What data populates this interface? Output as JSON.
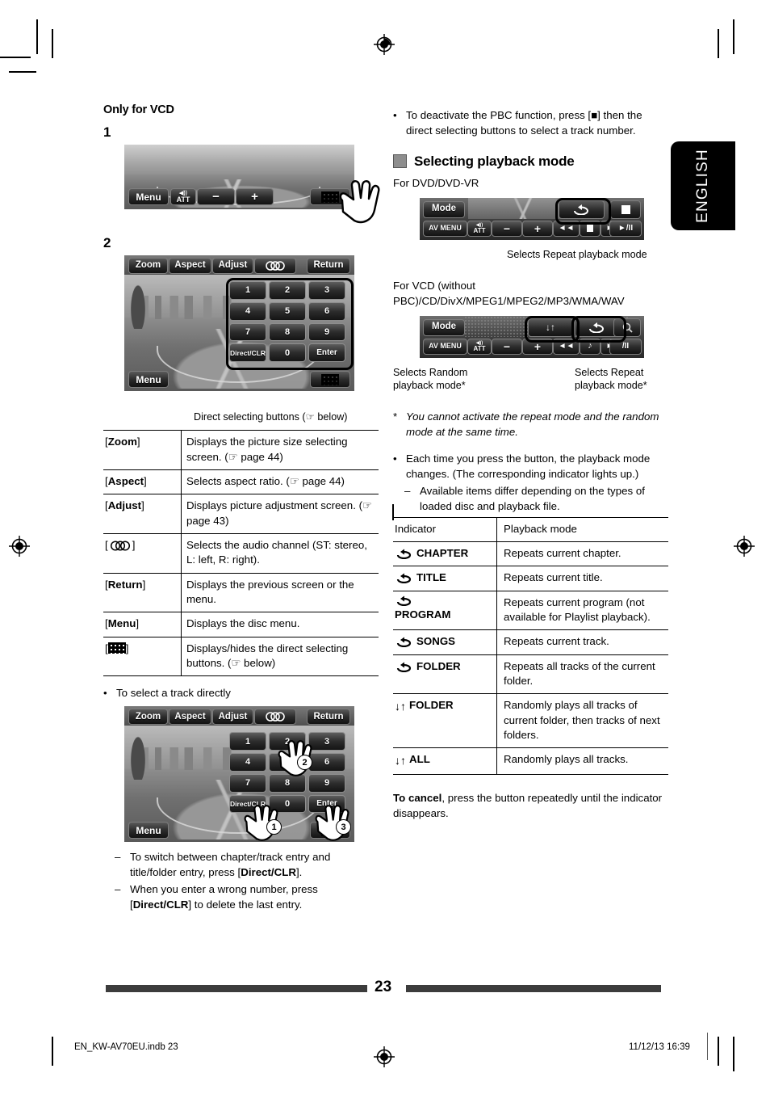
{
  "page": {
    "number": "23",
    "language_tab": "ENGLISH",
    "footer_file": "EN_KW-AV70EU.indb   23",
    "footer_datetime": "11/12/13   16:39"
  },
  "left_column": {
    "heading": "Only for VCD",
    "step1_number": "1",
    "step2_number": "2",
    "screen_toolbar": {
      "zoom": "Zoom",
      "aspect": "Aspect",
      "adjust": "Adjust",
      "audio_icon": "audio-channel-icon",
      "return": "Return",
      "menu": "Menu",
      "att": "ATT",
      "minus": "−",
      "plus": "+",
      "keypad_icon": "keypad-icon"
    },
    "keypad": {
      "keys": [
        "1",
        "2",
        "3",
        "4",
        "5",
        "6",
        "7",
        "8",
        "9",
        "Direct/CLR",
        "0",
        "Enter"
      ]
    },
    "keypad_caption": "Direct selecting buttons (☞ below)",
    "button_table": {
      "rows": [
        {
          "key": "[Zoom]",
          "key_bold": "Zoom",
          "desc": "Displays the picture size selecting screen. (☞ page 44)"
        },
        {
          "key": "[Aspect]",
          "key_bold": "Aspect",
          "desc": "Selects aspect ratio. (☞ page 44)"
        },
        {
          "key": "[Adjust]",
          "key_bold": "Adjust",
          "desc": "Displays picture adjustment screen. (☞ page 43)"
        },
        {
          "key": "[audio-icon]",
          "key_bold": "",
          "desc": "Selects the audio channel (ST: stereo, L: left, R: right)."
        },
        {
          "key": "[Return]",
          "key_bold": "Return",
          "desc": "Displays the previous screen or the menu."
        },
        {
          "key": "[Menu]",
          "key_bold": "Menu",
          "desc": "Displays the disc menu."
        },
        {
          "key": "[keypad-icon]",
          "key_bold": "",
          "desc": "Displays/hides the direct selecting buttons. (☞ below)"
        }
      ]
    },
    "track_bullet": "To select a track directly",
    "callout_numbers": [
      "1",
      "2",
      "3"
    ],
    "notes": [
      {
        "lead": "To switch between chapter/track entry and title/folder entry, press [",
        "bold": "Direct/CLR",
        "tail": "]."
      },
      {
        "lead": "When you enter a wrong number, press [",
        "bold": "Direct/CLR",
        "tail": "] to delete the last entry."
      }
    ]
  },
  "right_column": {
    "pbc_bullet": "To deactivate the PBC function, press [■] then the direct selecting buttons to select a track number.",
    "section_title": "Selecting playback mode",
    "dvd_label": "For DVD/DVD-VR",
    "dvd_bar": {
      "mode": "Mode",
      "av_menu": "AV MENU",
      "att": "ATT",
      "minus": "−",
      "plus": "+",
      "prev": "◄◄",
      "stop_small": "stop-icon",
      "next": "►►",
      "play_pause": "►/II",
      "repeat_icon": "repeat-icon",
      "stop_icon": "stop-icon"
    },
    "dvd_caption": "Selects Repeat playback mode",
    "vcd_label": "For VCD (without PBC)/CD/DivX/MPEG1/MPEG2/MP3/WMA/WAV",
    "vcd_bar": {
      "mode": "Mode",
      "av_menu": "AV MENU",
      "att": "ATT",
      "minus": "−",
      "plus": "+",
      "prev": "◄◄",
      "note_icon": "music-note-icon",
      "next": "►►",
      "play_pause": "/II",
      "random_icon": "random-icon",
      "repeat_icon": "repeat-icon"
    },
    "vcd_caption_left": "Selects Random playback mode*",
    "vcd_caption_right": "Selects Repeat playback mode*",
    "footnote": "You cannot activate the repeat mode and the random mode at the same time.",
    "footnote_mark": "*",
    "bullet_each": "Each time you press the button, the playback mode changes. (The corresponding indicator lights up.)",
    "dash_available": "Available items differ depending on the types of loaded disc and playback file.",
    "indicator_table": {
      "header": {
        "indicator": "Indicator",
        "mode": "Playback mode"
      },
      "rows": [
        {
          "icon": "repeat-icon",
          "label": "CHAPTER",
          "desc": "Repeats current chapter."
        },
        {
          "icon": "repeat-icon",
          "label": "TITLE",
          "desc": "Repeats current title."
        },
        {
          "icon": "repeat-icon",
          "label": "PROGRAM",
          "desc": "Repeats current program (not available for Playlist playback).",
          "wrap": true
        },
        {
          "icon": "repeat-icon",
          "label": "SONGS",
          "desc": "Repeats current track."
        },
        {
          "icon": "repeat-icon",
          "label": "FOLDER",
          "desc": "Repeats all tracks of the current folder."
        },
        {
          "icon": "random-icon",
          "label": "FOLDER",
          "desc": "Randomly plays all tracks of current folder, then tracks of next folders."
        },
        {
          "icon": "random-icon",
          "label": "ALL",
          "desc": "Randomly plays all tracks."
        }
      ]
    },
    "cancel_bold": "To cancel",
    "cancel_rest": ", press the button repeatedly until the indicator disappears."
  },
  "colors": {
    "text": "#000000",
    "tab_bg": "#000000",
    "tab_text": "#ffffff",
    "rule": "#3c3c3c"
  }
}
